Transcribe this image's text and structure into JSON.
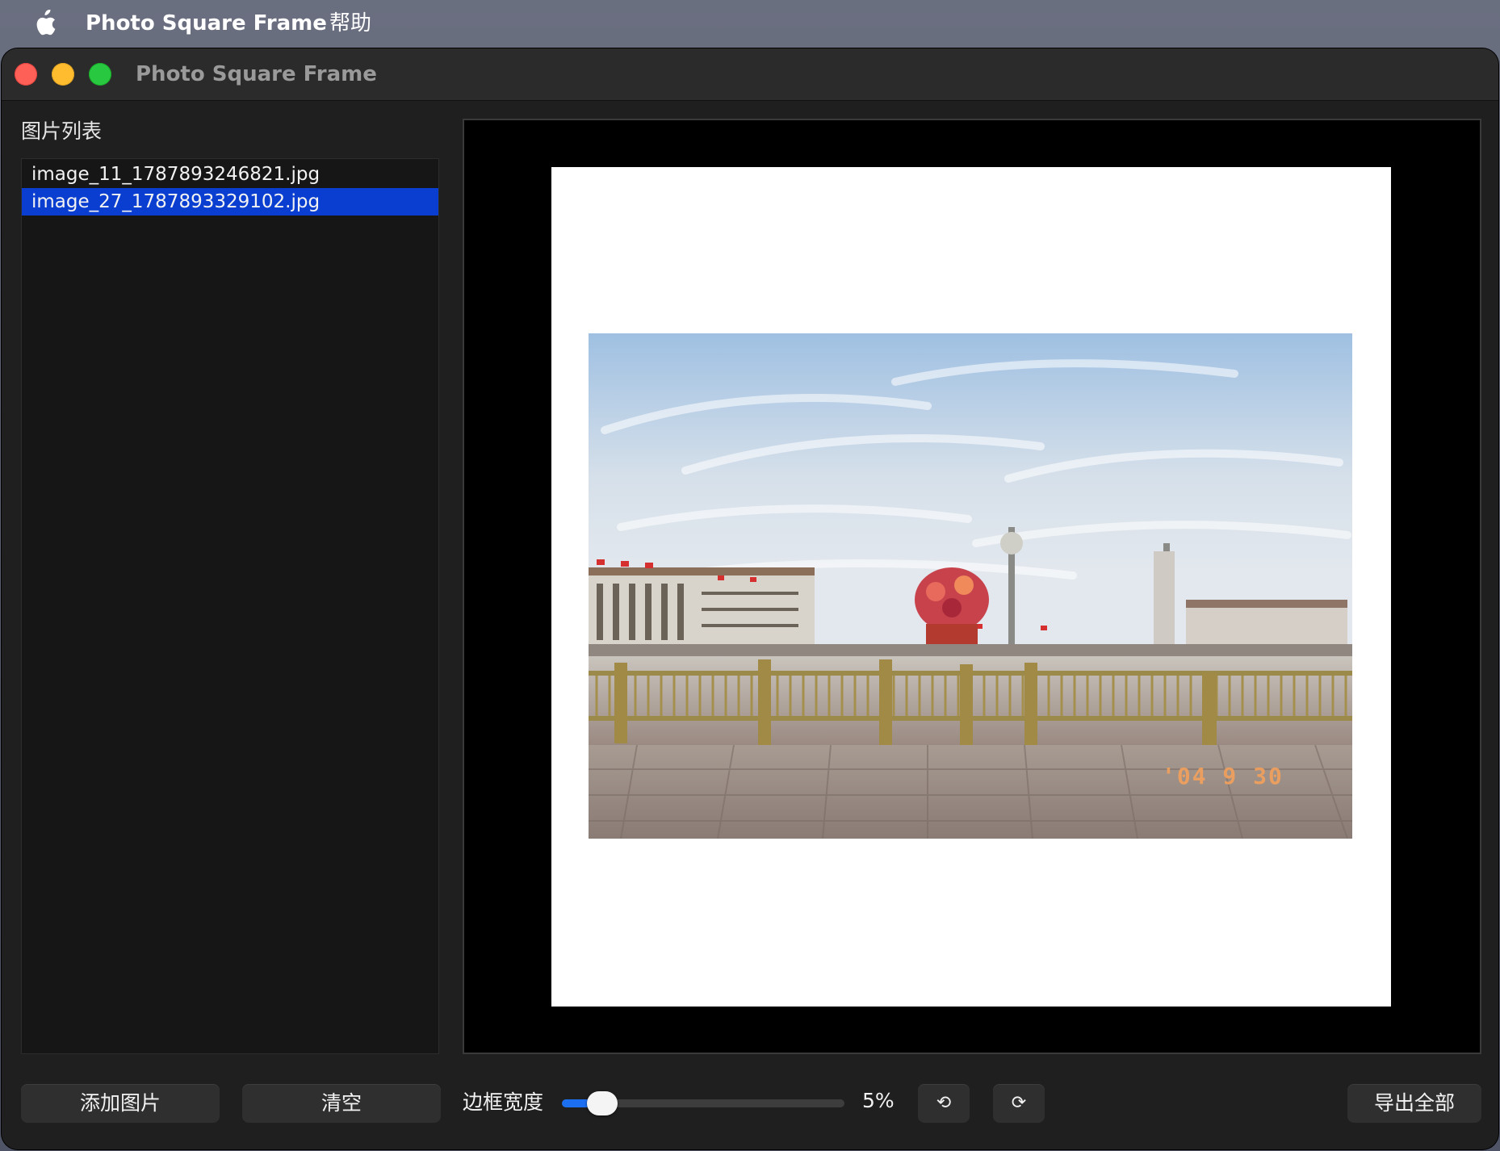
{
  "menubar": {
    "app_name": "Photo Square Frame",
    "help": "帮助"
  },
  "window": {
    "title": "Photo Square Frame"
  },
  "sidebar": {
    "heading": "图片列表",
    "files": [
      {
        "name": "image_11_1787893246821.jpg",
        "selected": false
      },
      {
        "name": "image_27_1787893329102.jpg",
        "selected": true
      }
    ]
  },
  "preview": {
    "photo_date_stamp": "'04 9 30",
    "frame_color": "#ffffff",
    "background_color": "#000000"
  },
  "toolbar": {
    "add_label": "添加图片",
    "clear_label": "清空",
    "border_width_label": "边框宽度",
    "border_width_value": "5%",
    "border_width_fraction": 0.05,
    "rotate_left_label": "⟲",
    "rotate_right_label": "⟳",
    "export_label": "导出全部"
  },
  "colors": {
    "accent": "#0a3ed1",
    "slider_fill": "#1d6ff2"
  },
  "icons": {
    "apple": "apple-icon",
    "rotate_left": "rotate-left-icon",
    "rotate_right": "rotate-right-icon"
  }
}
